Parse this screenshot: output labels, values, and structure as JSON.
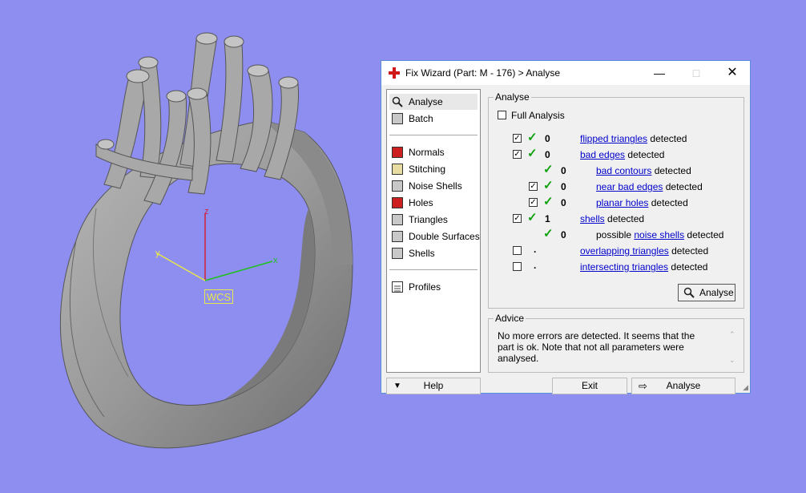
{
  "viewport": {
    "wcs_label": "WCS",
    "axis_x": "x",
    "axis_y": "y",
    "axis_z": "z"
  },
  "dialog": {
    "title": "Fix Wizard (Part: M - 176) > Analyse",
    "nav_items": [
      {
        "label": "Analyse",
        "icon": "magnifier-icon"
      },
      {
        "label": "Batch",
        "icon": "batch-icon"
      },
      {
        "label": "Normals",
        "icon": "normals-cube-icon"
      },
      {
        "label": "Stitching",
        "icon": "stitching-cube-icon"
      },
      {
        "label": "Noise Shells",
        "icon": "noise-shells-icon"
      },
      {
        "label": "Holes",
        "icon": "holes-cube-icon"
      },
      {
        "label": "Triangles",
        "icon": "triangles-cube-icon"
      },
      {
        "label": "Double Surfaces",
        "icon": "double-surfaces-cube-icon"
      },
      {
        "label": "Shells",
        "icon": "shells-cube-icon"
      },
      {
        "label": "Profiles",
        "icon": "profiles-icon"
      }
    ],
    "analyse_group_title": "Analyse",
    "full_analysis_label": "Full Analysis",
    "rows": [
      {
        "checked": true,
        "tick": true,
        "count": "0",
        "prefix": "",
        "link": "flipped triangles",
        "suffix": " detected"
      },
      {
        "checked": true,
        "tick": true,
        "count": "0",
        "prefix": "",
        "link": "bad edges",
        "suffix": " detected"
      },
      {
        "checked": null,
        "tick": true,
        "count": "0",
        "prefix": "",
        "link": "bad contours",
        "suffix": " detected"
      },
      {
        "checked": true,
        "tick": true,
        "count": "0",
        "prefix": "",
        "link": "near bad edges",
        "suffix": " detected"
      },
      {
        "checked": true,
        "tick": true,
        "count": "0",
        "prefix": "",
        "link": "planar holes",
        "suffix": " detected"
      },
      {
        "checked": true,
        "tick": true,
        "count": "1",
        "prefix": "",
        "link": "shells",
        "suffix": " detected"
      },
      {
        "checked": null,
        "tick": true,
        "count": "0",
        "prefix": "possible ",
        "link": "noise shells",
        "suffix": " detected"
      },
      {
        "checked": false,
        "tick": false,
        "count": ".",
        "prefix": "",
        "link": "overlapping triangles",
        "suffix": " detected"
      },
      {
        "checked": false,
        "tick": false,
        "count": ".",
        "prefix": "",
        "link": "intersecting triangles",
        "suffix": " detected"
      }
    ],
    "analyse_button_label": "Analyse",
    "advice_group_title": "Advice",
    "advice_text": "No more errors are detected. It seems that the part is ok. Note that not all parameters were analysed.",
    "help_label": "Help",
    "exit_label": "Exit",
    "bottom_analyse_label": "Analyse"
  }
}
